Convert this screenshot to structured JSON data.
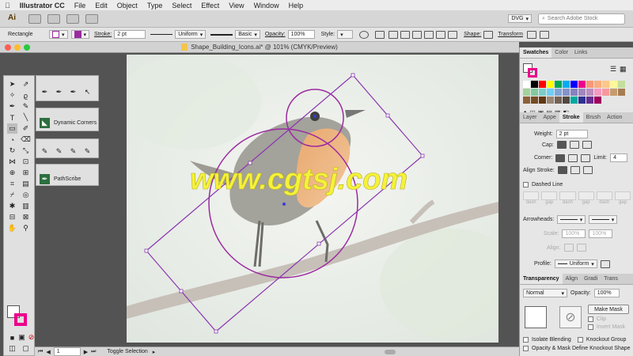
{
  "menubar": {
    "app_name": "Illustrator CC",
    "items": [
      "File",
      "Edit",
      "Object",
      "Type",
      "Select",
      "Effect",
      "View",
      "Window",
      "Help"
    ]
  },
  "appbar": {
    "logo": "Ai",
    "workspace": "DVG",
    "search_placeholder": "Search Adobe Stock"
  },
  "control_bar": {
    "tool_name": "Rectangle",
    "stroke_label": "Stroke:",
    "stroke_value": "2 pt",
    "profile_value": "Uniform",
    "brush_value": "Basic",
    "opacity_label": "Opacity:",
    "opacity_value": "100%",
    "style_label": "Style:",
    "shape_label": "Shape:",
    "transform_label": "Transform"
  },
  "document": {
    "title": "Shape_Building_Icons.ai* @ 101% (CMYK/Preview)",
    "watermark": "www.cgtsj.com"
  },
  "flyouts": {
    "dynamic_corners": "Dynamic Corners",
    "pathscribe": "PathScribe"
  },
  "swatches_panel": {
    "tabs": [
      "Swatches",
      "Color",
      "Links"
    ],
    "swatch_colors": [
      "#ffffff",
      "#000000",
      "#ff0000",
      "#ffff00",
      "#00a651",
      "#00aeef",
      "#0000ff",
      "#ec008c",
      "#f7977a",
      "#f9ad81",
      "#fdc68a",
      "#fff79a",
      "#c4df9b",
      "#a2d39c",
      "#82ca9d",
      "#7bcdc8",
      "#6ecff6",
      "#7ea7d8",
      "#8493ca",
      "#8882be",
      "#a187be",
      "#bc8dbf",
      "#f49ac2",
      "#f6989d",
      "#c69c6d",
      "#a67c52",
      "#8c6239",
      "#754c24",
      "#603913",
      "#998675",
      "#736357",
      "#534741",
      "#00a99d",
      "#2e3192",
      "#662d91",
      "#9e005d"
    ]
  },
  "stroke_panel": {
    "tabs": [
      "Layer",
      "Appe",
      "Stroke",
      "Brush",
      "Action"
    ],
    "weight_label": "Weight:",
    "weight_value": "2 pt",
    "cap_label": "Cap:",
    "corner_label": "Corner:",
    "limit_label": "Limit:",
    "limit_value": "4",
    "align_label": "Align Stroke:",
    "dashed_label": "Dashed Line",
    "dash_labels": [
      "dash",
      "gap",
      "dash",
      "gap",
      "dash",
      "gap"
    ],
    "arrowheads_label": "Arrowheads:",
    "scale_label": "Scale:",
    "scale_values": [
      "100%",
      "100%"
    ],
    "align_arrow_label": "Align:",
    "profile_label": "Profile:",
    "profile_value": "Uniform"
  },
  "transparency_panel": {
    "tabs": [
      "Transparency",
      "Align",
      "Gradi",
      "Trans"
    ],
    "blend_mode": "Normal",
    "opacity_label": "Opacity:",
    "opacity_value": "100%",
    "make_mask": "Make Mask",
    "clip": "Clip",
    "invert_mask": "Invert Mask",
    "isolate": "Isolate Blending",
    "knockout": "Knockout Group",
    "opacity_mask_line": "Opacity & Mask Define Knockout Shape"
  },
  "status_bar": {
    "page": "1",
    "tool_status": "Toggle Selection"
  },
  "colors": {
    "stroke_purple": "#9b2aa0",
    "watermark_yellow": "#f5f23a",
    "selection_purple": "#8a35b0"
  }
}
